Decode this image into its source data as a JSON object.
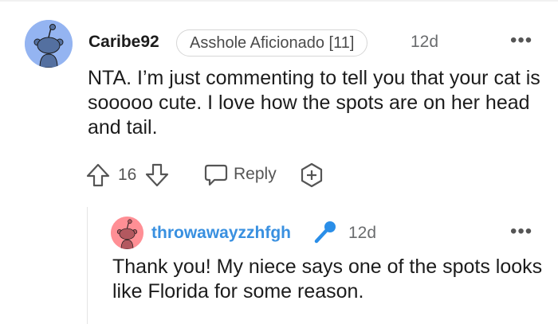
{
  "comment": {
    "author": "Caribe92",
    "flair": "Asshole Aficionado [11]",
    "age": "12d",
    "more_label": "•••",
    "body": "NTA. I’m just commenting to tell you that your cat is sooooo cute. I love how the spots are on her head and tail.",
    "votes": "16",
    "reply_label": "Reply",
    "avatar_color": "#94b4f1"
  },
  "reply": {
    "author": "throwawayzzhfgh",
    "age": "12d",
    "more_label": "•••",
    "body": "Thank you! My niece says one of the spots looks like Florida for some reason.",
    "author_color": "#3990e0",
    "avatar_color": "#ff8f95",
    "badge_icon": "microphone-icon",
    "badge_color": "#2a8ee8"
  }
}
